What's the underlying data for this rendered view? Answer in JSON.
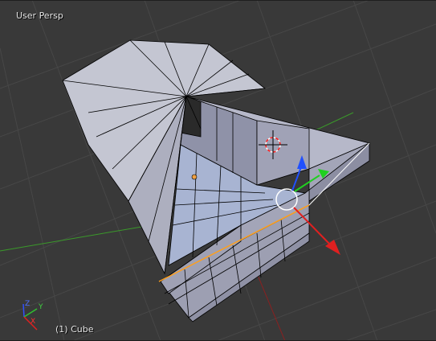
{
  "viewport": {
    "view_name": "User Persp",
    "object_info": "(1) Cube"
  },
  "axis_widget": {
    "x_label": "X",
    "y_label": "Y",
    "z_label": "Z"
  },
  "colors": {
    "background": "#393939",
    "grid_line": "#464646",
    "x_axis": "#b02020",
    "y_axis": "#3a9a2a",
    "mesh_face": "#a9abbd",
    "mesh_face_dark": "#7e8096",
    "mesh_edge": "#000000",
    "selected_edge": "#ff9f1a",
    "manipulator_x": "#e02020",
    "manipulator_y": "#20d020",
    "manipulator_z": "#2050ff"
  }
}
